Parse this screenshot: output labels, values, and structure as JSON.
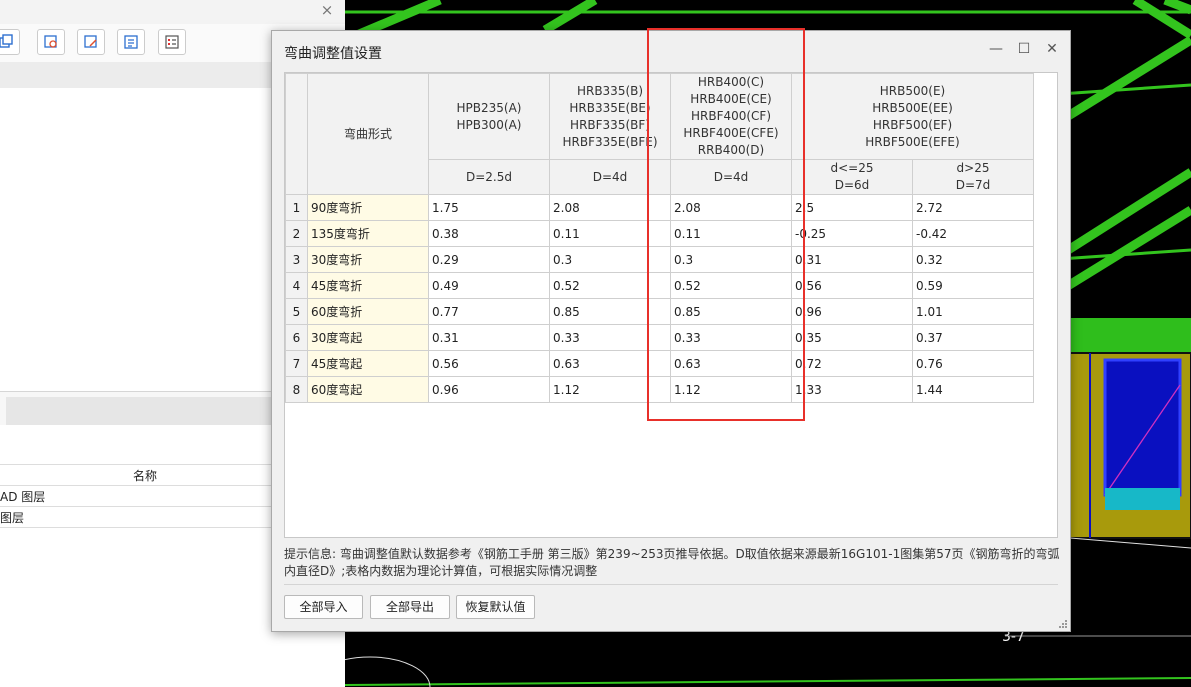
{
  "left_panel": {
    "close_label": "×",
    "layer_table": {
      "header": "名称",
      "rows": [
        "AD 图层",
        "图层"
      ]
    }
  },
  "cad": {
    "label": "3-7"
  },
  "dialog": {
    "title": "弯曲调整值设置",
    "window_buttons": {
      "minimize": "—",
      "maximize": "☐",
      "close": "✕"
    },
    "table": {
      "bend_form_header": "弯曲形式",
      "groups": [
        {
          "grades": "HPB235(A)\nHPB300(A)",
          "sub": [
            "D=2.5d"
          ]
        },
        {
          "grades": "HRB335(B)\nHRB335E(BE)\nHRBF335(BF)\nHRBF335E(BFE)",
          "sub": [
            "D=4d"
          ]
        },
        {
          "grades": "HRB400(C)\nHRB400E(CE)\nHRBF400(CF)\nHRBF400E(CFE)\nRRB400(D)",
          "sub": [
            "D=4d"
          ]
        },
        {
          "grades": "HRB500(E)\nHRB500E(EE)\nHRBF500(EF)\nHRBF500E(EFE)",
          "sub": [
            "d<=25\nD=6d",
            "d>25\nD=7d"
          ]
        }
      ],
      "rows": [
        {
          "num": "1",
          "name": "90度弯折",
          "values": [
            "1.75",
            "2.08",
            "2.08",
            "2.5",
            "2.72"
          ]
        },
        {
          "num": "2",
          "name": "135度弯折",
          "values": [
            "0.38",
            "0.11",
            "0.11",
            "-0.25",
            "-0.42"
          ]
        },
        {
          "num": "3",
          "name": "30度弯折",
          "values": [
            "0.29",
            "0.3",
            "0.3",
            "0.31",
            "0.32"
          ]
        },
        {
          "num": "4",
          "name": "45度弯折",
          "values": [
            "0.49",
            "0.52",
            "0.52",
            "0.56",
            "0.59"
          ]
        },
        {
          "num": "5",
          "name": "60度弯折",
          "values": [
            "0.77",
            "0.85",
            "0.85",
            "0.96",
            "1.01"
          ]
        },
        {
          "num": "6",
          "name": "30度弯起",
          "values": [
            "0.31",
            "0.33",
            "0.33",
            "0.35",
            "0.37"
          ]
        },
        {
          "num": "7",
          "name": "45度弯起",
          "values": [
            "0.56",
            "0.63",
            "0.63",
            "0.72",
            "0.76"
          ]
        },
        {
          "num": "8",
          "name": "60度弯起",
          "values": [
            "0.96",
            "1.12",
            "1.12",
            "1.33",
            "1.44"
          ]
        }
      ]
    },
    "hint": "提示信息: 弯曲调整值默认数据参考《钢筋工手册 第三版》第239~253页推导依据。D取值依据来源最新16G101-1图集第57页《钢筋弯折的弯弧内直径D》;表格内数据为理论计算值，可根据实际情况调整",
    "buttons": {
      "import_all": "全部导入",
      "export_all": "全部导出",
      "restore_default": "恢复默认值"
    }
  },
  "colors": {
    "highlight_border": "#e8302a",
    "cad_background": "#000000",
    "cad_grid": "#33c41e",
    "bend_name_bg": "#fffbe5"
  }
}
